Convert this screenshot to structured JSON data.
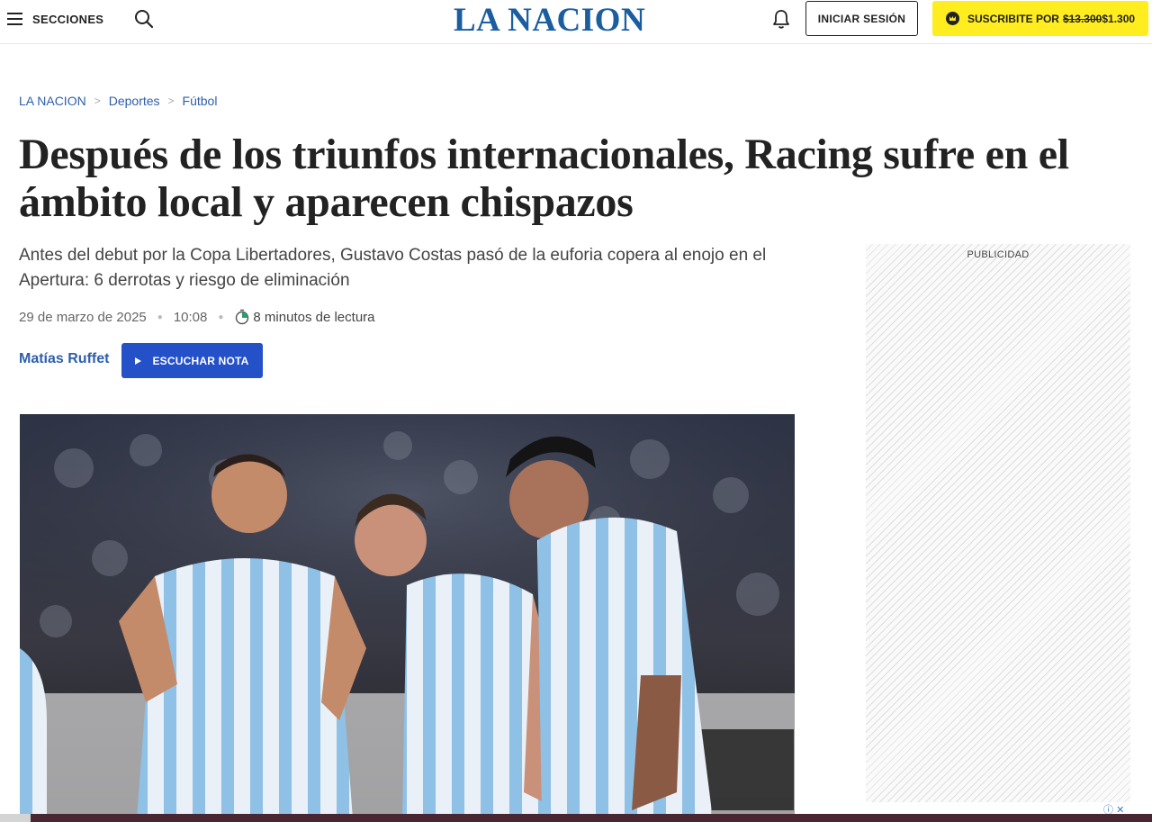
{
  "header": {
    "menu_label": "SECCIONES",
    "logo": "LA NACION",
    "login_label": "INICIAR SESIÓN",
    "subscribe_label": "SUSCRIBITE POR",
    "subscribe_old_price": "$13.300",
    "subscribe_new_price": "$1.300"
  },
  "breadcrumb": {
    "items": [
      "LA NACION",
      "Deportes",
      "Fútbol"
    ],
    "separator": ">"
  },
  "article": {
    "title": "Después de los triunfos internacionales, Racing sufre en el ámbito local y aparecen chispazos",
    "subtitle": "Antes del debut por la Copa Libertadores, Gustavo Costas pasó de la euforia copera al enojo en el Apertura: 6 derrotas y riesgo de eliminación",
    "date": "29 de marzo de 2025",
    "time": "10:08",
    "reading_time": "8 minutos de lectura",
    "author": "Matías Ruffet",
    "listen_label": "ESCUCHAR NOTA"
  },
  "ad": {
    "label": "PUBLICIDAD"
  },
  "colors": {
    "brand_blue": "#1b5ea0",
    "link_blue": "#2f5fa8",
    "button_blue": "#2450c8",
    "subscribe_yellow": "#ffed1f"
  },
  "icons": {
    "menu": "hamburger-icon",
    "search": "search-icon",
    "notifications": "bell-icon",
    "subscribe": "crown-icon",
    "reading": "timer-icon",
    "listen": "play-icon",
    "ad_info": "info-icon",
    "ad_close": "close-icon"
  }
}
